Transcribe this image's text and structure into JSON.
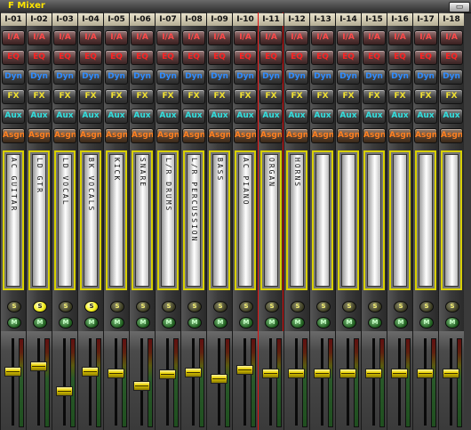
{
  "window": {
    "title": "F Mixer",
    "close_glyph": "▭"
  },
  "buttons": {
    "io": "I/A",
    "eq": "EQ",
    "dyn": "Dyn",
    "fx": "FX",
    "aux": "Aux",
    "asgn": "Asgn",
    "solo": "S",
    "mute": "M"
  },
  "channels": [
    {
      "label": "I-01",
      "scribble": "AC GUITAR",
      "solo_on": false,
      "fader": 0.62,
      "selected": false
    },
    {
      "label": "I-02",
      "scribble": "LD GTR",
      "solo_on": true,
      "fader": 0.7,
      "selected": false
    },
    {
      "label": "I-03",
      "scribble": "LD VOCAL",
      "solo_on": false,
      "fader": 0.36,
      "selected": false
    },
    {
      "label": "I-04",
      "scribble": "BK VOCALS",
      "solo_on": true,
      "fader": 0.62,
      "selected": false
    },
    {
      "label": "I-05",
      "scribble": "KICK",
      "solo_on": false,
      "fader": 0.6,
      "selected": false
    },
    {
      "label": "I-06",
      "scribble": "SNARE",
      "solo_on": false,
      "fader": 0.43,
      "selected": false
    },
    {
      "label": "I-07",
      "scribble": "L/R DRUMS",
      "solo_on": false,
      "fader": 0.59,
      "selected": false
    },
    {
      "label": "I-08",
      "scribble": "L/R PERCUSSION",
      "solo_on": false,
      "fader": 0.61,
      "selected": false
    },
    {
      "label": "I-09",
      "scribble": "BASS",
      "solo_on": false,
      "fader": 0.53,
      "selected": false
    },
    {
      "label": "I-10",
      "scribble": "AC PIANO",
      "solo_on": false,
      "fader": 0.65,
      "selected": false
    },
    {
      "label": "I-11",
      "scribble": "ORGAN",
      "solo_on": false,
      "fader": 0.6,
      "selected": true
    },
    {
      "label": "I-12",
      "scribble": "HORNS",
      "solo_on": false,
      "fader": 0.6,
      "selected": false
    },
    {
      "label": "I-13",
      "scribble": "",
      "solo_on": false,
      "fader": 0.6,
      "selected": false
    },
    {
      "label": "I-14",
      "scribble": "",
      "solo_on": false,
      "fader": 0.6,
      "selected": false
    },
    {
      "label": "I-15",
      "scribble": "",
      "solo_on": false,
      "fader": 0.6,
      "selected": false
    },
    {
      "label": "I-16",
      "scribble": "",
      "solo_on": false,
      "fader": 0.6,
      "selected": false
    },
    {
      "label": "I-17",
      "scribble": "",
      "solo_on": false,
      "fader": 0.6,
      "selected": false
    },
    {
      "label": "I-18",
      "scribble": "",
      "solo_on": false,
      "fader": 0.6,
      "selected": false
    }
  ]
}
